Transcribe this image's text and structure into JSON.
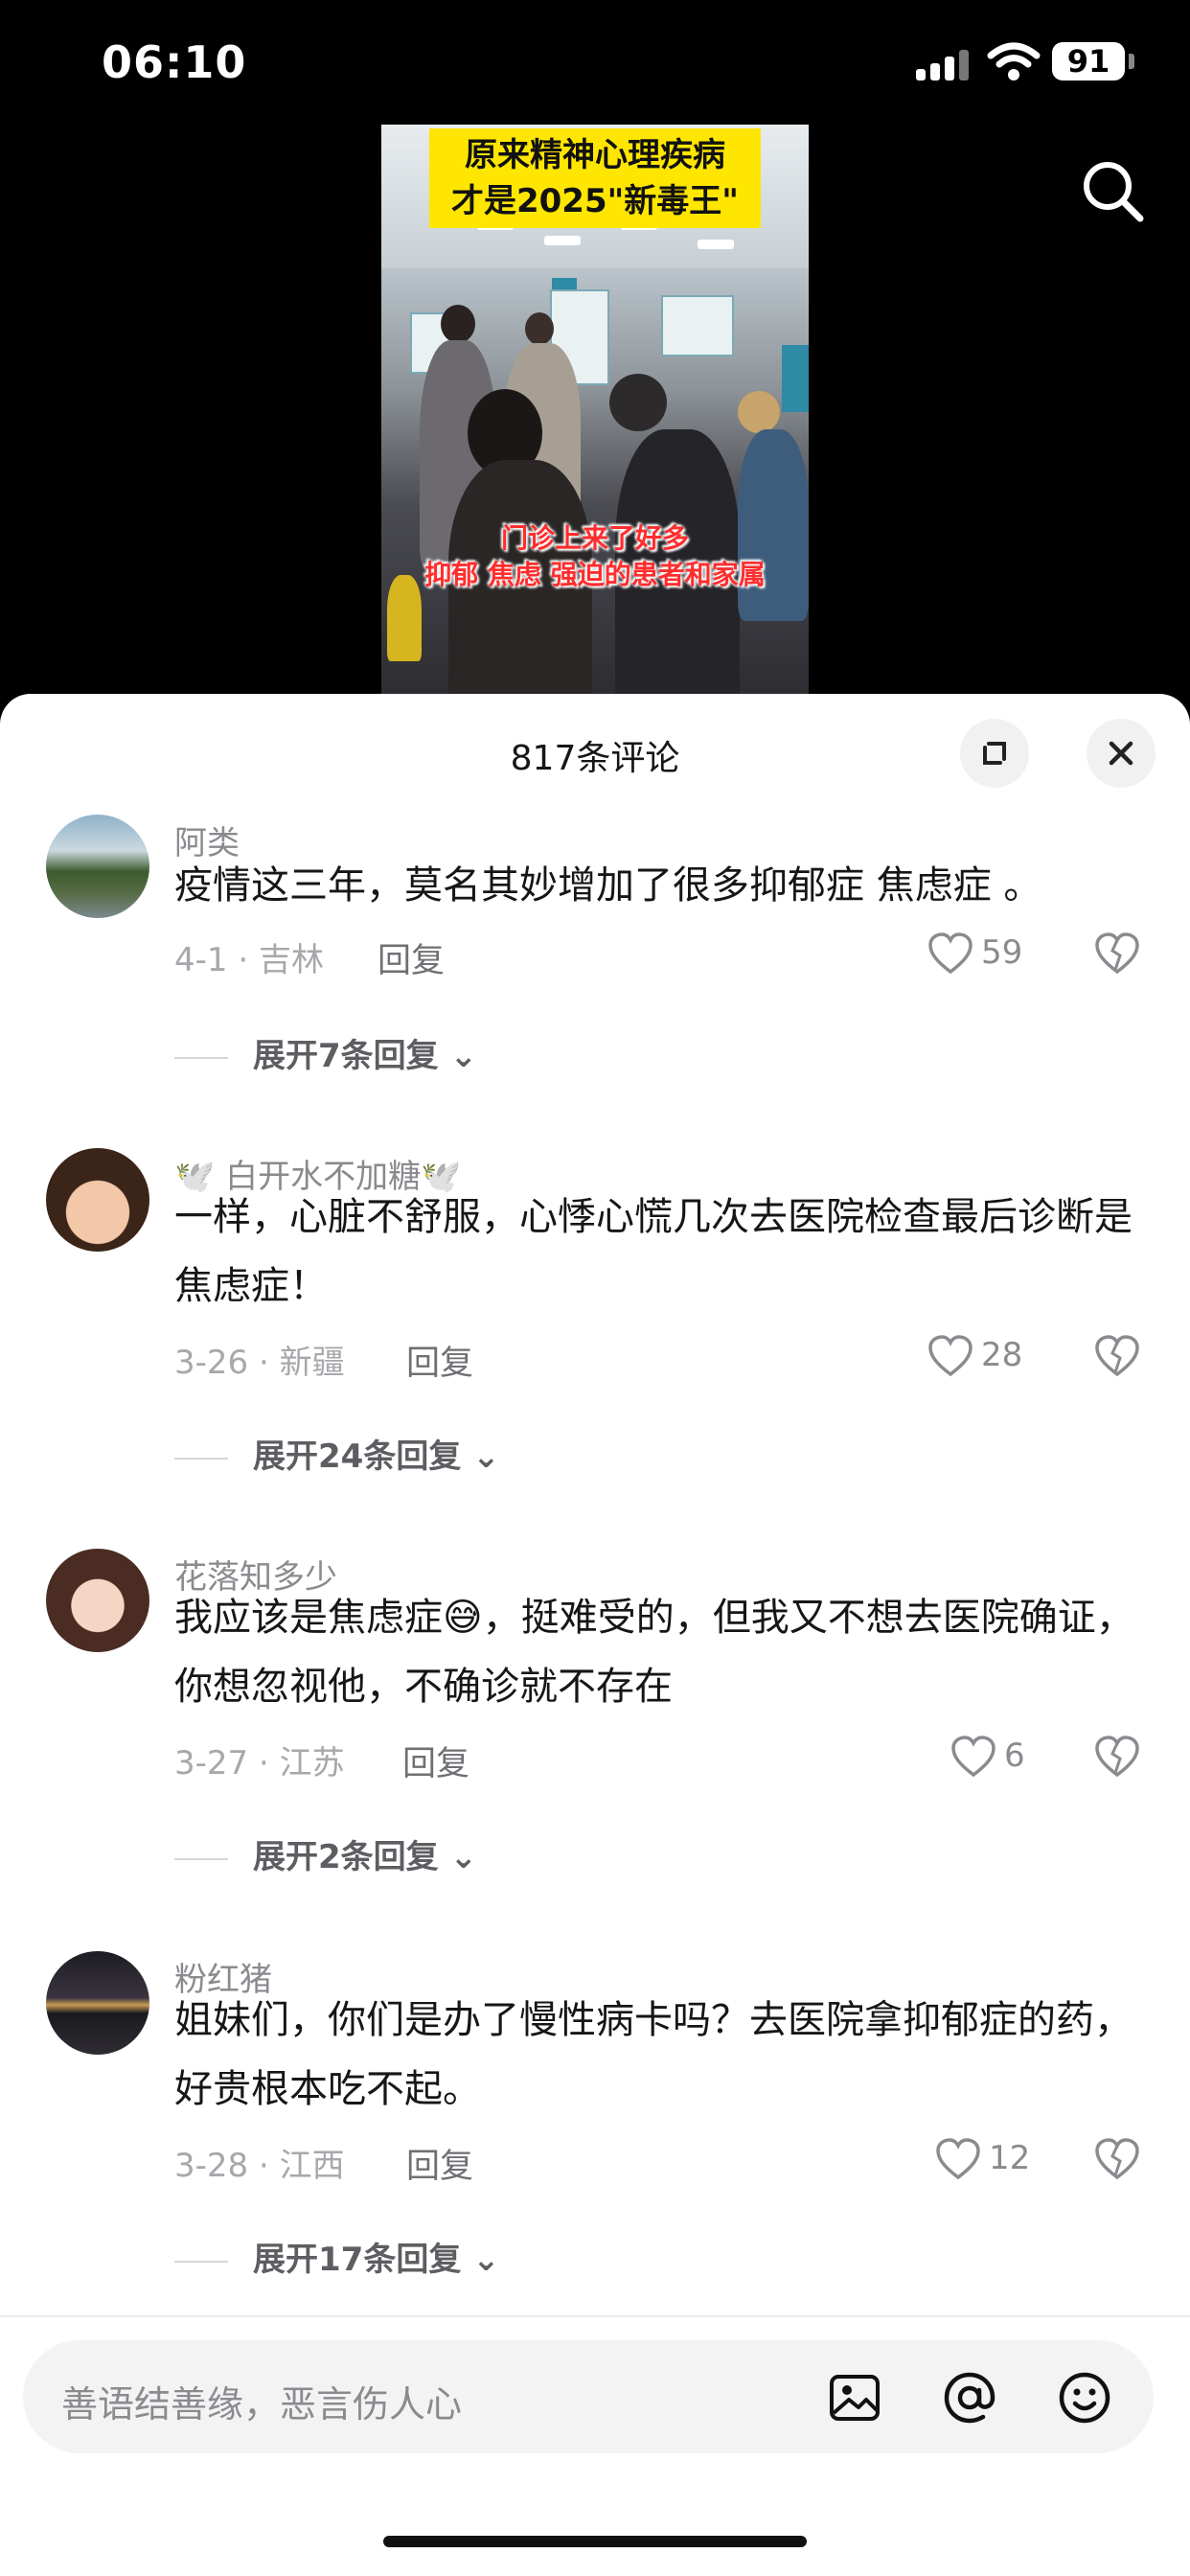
{
  "status": {
    "time": "06:10",
    "battery": "91"
  },
  "video": {
    "title_line1": "原来精神心理疾病",
    "title_line2": "才是2025\"新毒王\"",
    "caption_line1": "门诊上来了好多",
    "caption_line2": "抑郁 焦虑 强迫的患者和家属"
  },
  "sheet": {
    "title": "817条评论"
  },
  "comments": [
    {
      "user": "阿类",
      "text": "疫情这三年，莫名其妙增加了很多抑郁症 焦虑症 。",
      "date_loc": "4-1 · 吉林",
      "reply": "回复",
      "likes": "59",
      "expand": "展开7条回复"
    },
    {
      "user": "🕊️ 白开水不加糖🕊️",
      "text": "一样，心脏不舒服，心悸心慌几次去医院检查最后诊断是焦虑症！",
      "date_loc": "3-26 · 新疆",
      "reply": "回复",
      "likes": "28",
      "expand": "展开24条回复"
    },
    {
      "user": "花落知多少",
      "text": "我应该是焦虑症😅，挺难受的，但我又不想去医院确证，你想忽视他，不确诊就不存在",
      "date_loc": "3-27 · 江苏",
      "reply": "回复",
      "likes": "6",
      "expand": "展开2条回复"
    },
    {
      "user": "粉红猪",
      "text": "姐妹们，你们是办了慢性病卡吗？去医院拿抑郁症的药，好贵根本吃不起。",
      "date_loc": "3-28 · 江西",
      "reply": "回复",
      "likes": "12",
      "expand": "展开17条回复"
    }
  ],
  "input": {
    "placeholder": "善语结善缘，恶言伤人心"
  }
}
